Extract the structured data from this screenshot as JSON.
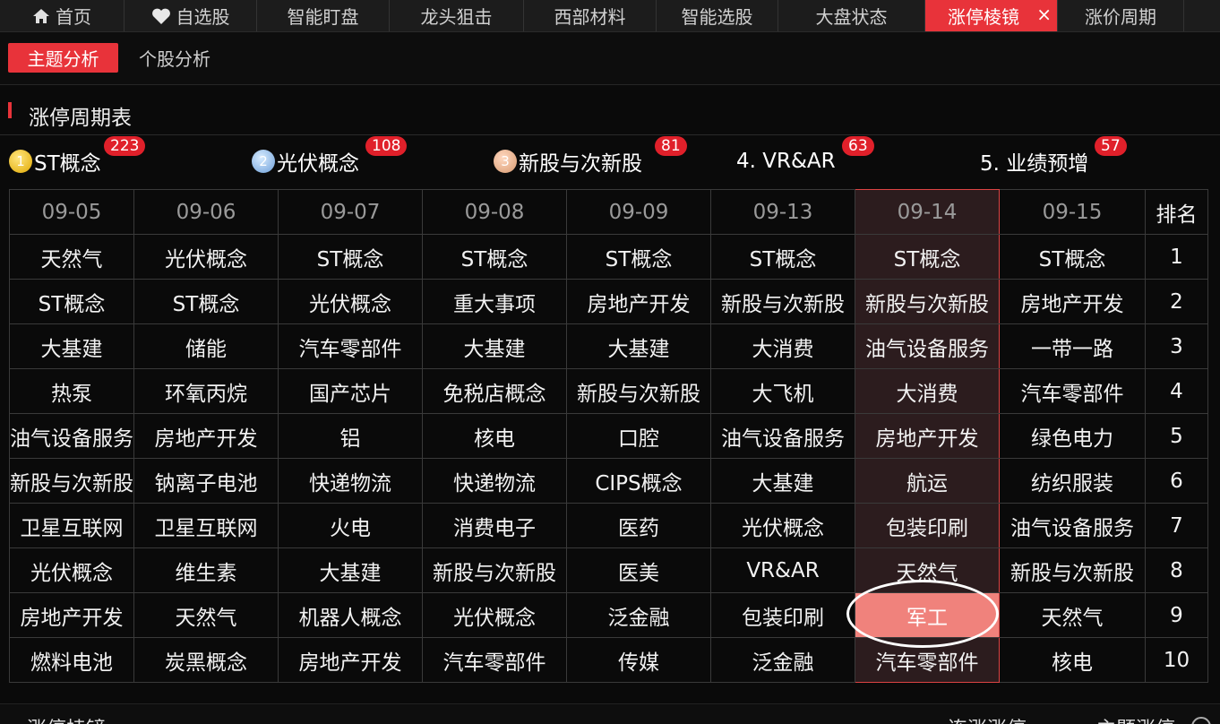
{
  "top_tabs": [
    {
      "label": "首页",
      "icon": "home-icon"
    },
    {
      "label": "自选股",
      "icon": "heart-icon"
    },
    {
      "label": "智能盯盘"
    },
    {
      "label": "龙头狙击"
    },
    {
      "label": "西部材料"
    },
    {
      "label": "智能选股"
    },
    {
      "label": "大盘状态"
    },
    {
      "label": "涨停棱镜",
      "active": true,
      "close": "×"
    },
    {
      "label": "涨价周期"
    }
  ],
  "sub_tabs": {
    "theme": "主题分析",
    "stock": "个股分析"
  },
  "section_title": "涨停周期表",
  "themes": [
    {
      "medal": "1",
      "label": "ST概念",
      "count": "223"
    },
    {
      "medal": "2",
      "label": "光伏概念",
      "count": "108"
    },
    {
      "medal": "3",
      "label": "新股与次新股",
      "count": "81"
    },
    {
      "label": "4. VR&AR",
      "count": "63"
    },
    {
      "label": "5. 业绩预增",
      "count": "57"
    }
  ],
  "table": {
    "dates": [
      "09-05",
      "09-06",
      "09-07",
      "09-08",
      "09-09",
      "09-13",
      "09-14",
      "09-15"
    ],
    "rank_header": "排名",
    "rows": [
      {
        "rank": "1",
        "cells": [
          "天然气",
          "光伏概念",
          "ST概念",
          "ST概念",
          "ST概念",
          "ST概念",
          "ST概念",
          "ST概念"
        ]
      },
      {
        "rank": "2",
        "cells": [
          "ST概念",
          "ST概念",
          "光伏概念",
          "重大事项",
          "房地产开发",
          "新股与次新股",
          "新股与次新股",
          "房地产开发"
        ]
      },
      {
        "rank": "3",
        "cells": [
          "大基建",
          "储能",
          "汽车零部件",
          "大基建",
          "大基建",
          "大消费",
          "油气设备服务",
          "一带一路"
        ]
      },
      {
        "rank": "4",
        "cells": [
          "热泵",
          "环氧丙烷",
          "国产芯片",
          "免税店概念",
          "新股与次新股",
          "大飞机",
          "大消费",
          "汽车零部件"
        ]
      },
      {
        "rank": "5",
        "cells": [
          "油气设备服务",
          "房地产开发",
          "铝",
          "核电",
          "口腔",
          "油气设备服务",
          "房地产开发",
          "绿色电力"
        ]
      },
      {
        "rank": "6",
        "cells": [
          "新股与次新股",
          "钠离子电池",
          "快递物流",
          "快递物流",
          "CIPS概念",
          "大基建",
          "航运",
          "纺织服装"
        ]
      },
      {
        "rank": "7",
        "cells": [
          "卫星互联网",
          "卫星互联网",
          "火电",
          "消费电子",
          "医药",
          "光伏概念",
          "包装印刷",
          "油气设备服务"
        ]
      },
      {
        "rank": "8",
        "cells": [
          "光伏概念",
          "维生素",
          "大基建",
          "新股与次新股",
          "医美",
          "VR&AR",
          "天然气",
          "新股与次新股"
        ]
      },
      {
        "rank": "9",
        "cells": [
          "房地产开发",
          "天然气",
          "机器人概念",
          "光伏概念",
          "泛金融",
          "包装印刷",
          "军工",
          "天然气"
        ]
      },
      {
        "rank": "10",
        "cells": [
          "燃料电池",
          "炭黑概念",
          "房地产开发",
          "汽车零部件",
          "传媒",
          "泛金融",
          "汽车零部件",
          "核电"
        ]
      }
    ]
  },
  "bottom": {
    "left": "涨停棱镜",
    "right1": "连涨涨停",
    "right2": "主题涨停"
  },
  "colors": {
    "accent": "#e8333a",
    "highlight_cell": "#f0827c"
  }
}
